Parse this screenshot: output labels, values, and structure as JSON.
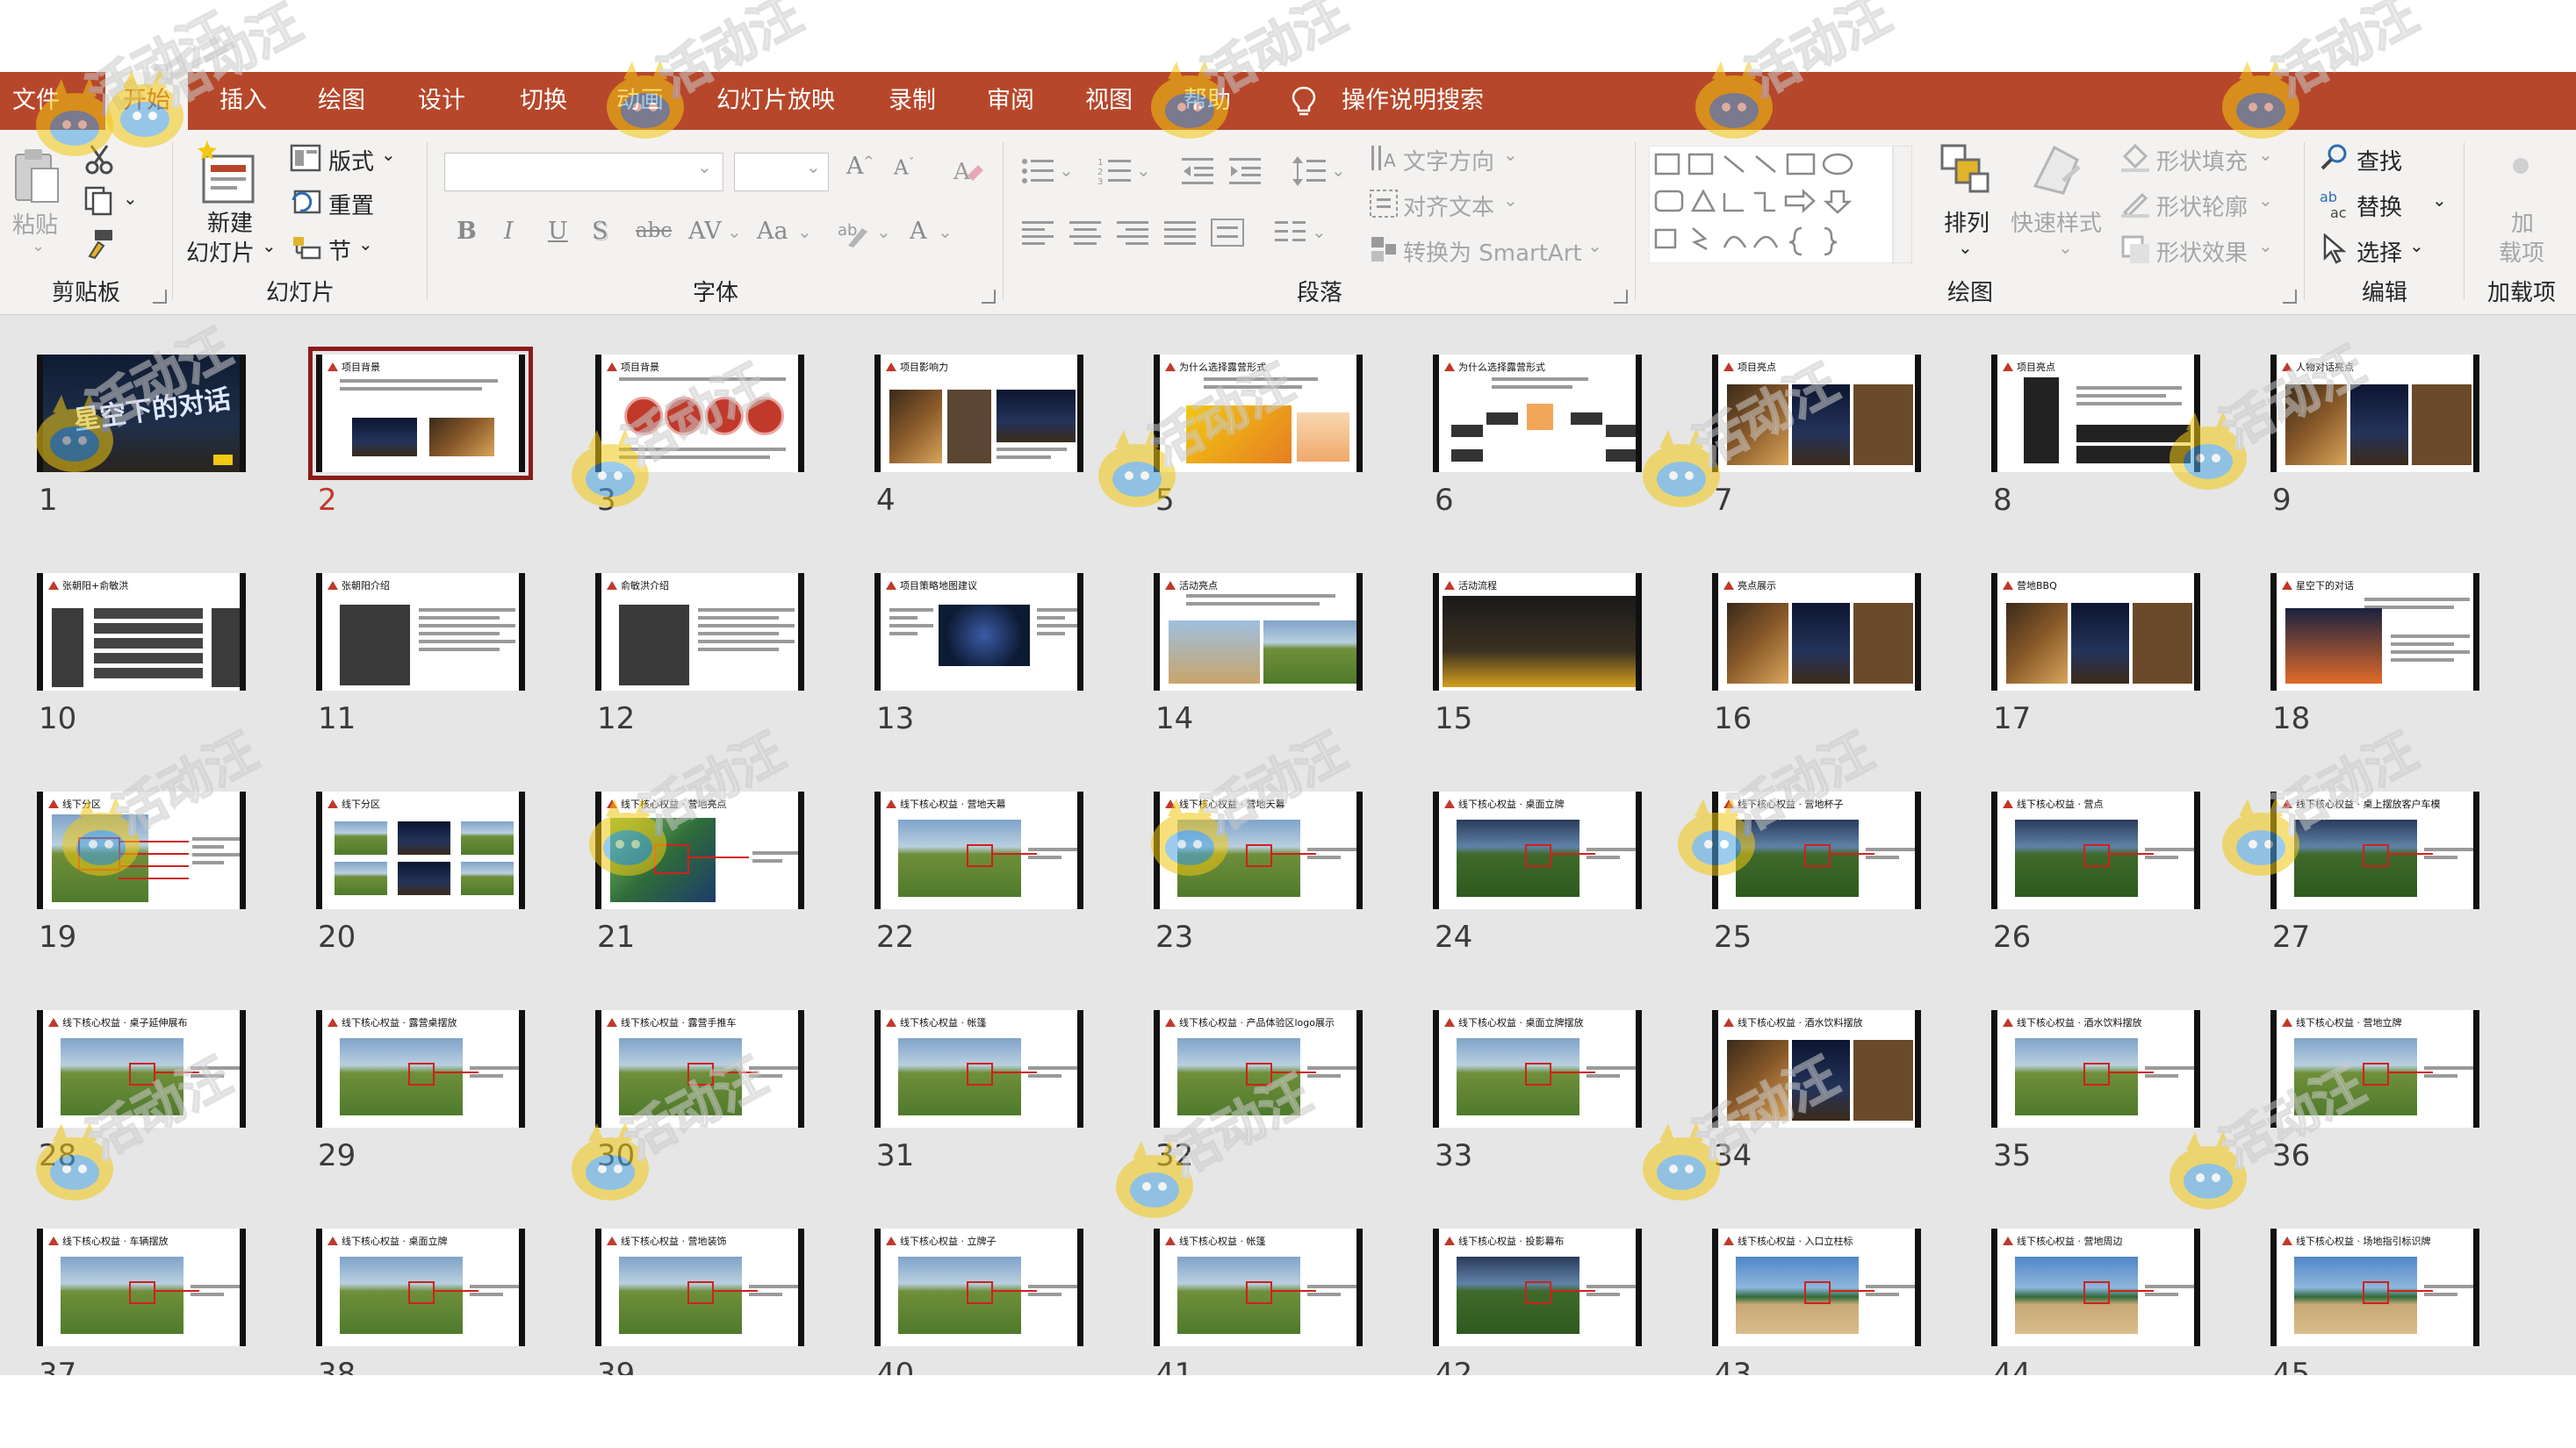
{
  "colors": {
    "accent": "#b7472a",
    "ribbon_bg": "#f3f2f1",
    "sorter_bg": "#e6e6e6",
    "selection": "#8b1b1b",
    "slide_red": "#c0392b"
  },
  "tabs": [
    {
      "label": "文件",
      "active": false
    },
    {
      "label": "开始",
      "active": true
    },
    {
      "label": "插入",
      "active": false
    },
    {
      "label": "绘图",
      "active": false
    },
    {
      "label": "设计",
      "active": false
    },
    {
      "label": "切换",
      "active": false
    },
    {
      "label": "动画",
      "active": false
    },
    {
      "label": "幻灯片放映",
      "active": false
    },
    {
      "label": "录制",
      "active": false
    },
    {
      "label": "审阅",
      "active": false
    },
    {
      "label": "视图",
      "active": false
    },
    {
      "label": "帮助",
      "active": false
    }
  ],
  "tell_me": {
    "label": "操作说明搜索",
    "icon": "lightbulb-icon"
  },
  "ribbon": {
    "clipboard": {
      "paste": "粘贴",
      "label": "剪贴板"
    },
    "slides": {
      "new_slide_line1": "新建",
      "new_slide_line2": "幻灯片",
      "layout": "版式",
      "reset": "重置",
      "section": "节",
      "label": "幻灯片"
    },
    "font": {
      "label": "字体",
      "bold": "B",
      "italic": "I",
      "underline": "U",
      "shadow": "S",
      "strike": "abc",
      "spacing": "AV",
      "case": "Aa",
      "color": "A"
    },
    "paragraph": {
      "text_direction": "文字方向",
      "align_text": "对齐文本",
      "smartart": "转换为 SmartArt",
      "label": "段落"
    },
    "drawing": {
      "arrange": "排列",
      "quick_styles": "快速样式",
      "shape_fill": "形状填充",
      "shape_outline": "形状轮廓",
      "shape_effects": "形状效果",
      "label": "绘图"
    },
    "editing": {
      "find": "查找",
      "replace": "替换",
      "select": "选择",
      "label": "编辑"
    },
    "addins": {
      "line1": "加",
      "line2": "载项",
      "label": "加载项"
    }
  },
  "slides": [
    {
      "n": "1",
      "title": "",
      "kind": "cover",
      "big": "星空下的对话"
    },
    {
      "n": "2",
      "title": "项目背景",
      "kind": "two-photo",
      "selected": true
    },
    {
      "n": "3",
      "title": "项目背景",
      "kind": "dots"
    },
    {
      "n": "4",
      "title": "项目影响力",
      "kind": "photo-dark"
    },
    {
      "n": "5",
      "title": "为什么选择露营形式",
      "kind": "chart"
    },
    {
      "n": "6",
      "title": "为什么选择露营形式",
      "kind": "flow"
    },
    {
      "n": "7",
      "title": "项目亮点",
      "kind": "photos3"
    },
    {
      "n": "8",
      "title": "项目亮点",
      "kind": "phone"
    },
    {
      "n": "9",
      "title": "人物对话亮点",
      "kind": "photos3"
    },
    {
      "n": "10",
      "title": "张朝阳+俞敏洪",
      "kind": "people"
    },
    {
      "n": "11",
      "title": "张朝阳介绍",
      "kind": "person"
    },
    {
      "n": "12",
      "title": "俞敏洪介绍",
      "kind": "person"
    },
    {
      "n": "13",
      "title": "项目策略地图建议",
      "kind": "map"
    },
    {
      "n": "14",
      "title": "活动亮点",
      "kind": "landscape"
    },
    {
      "n": "15",
      "title": "活动流程",
      "kind": "dark-wide"
    },
    {
      "n": "16",
      "title": "亮点展示",
      "kind": "photos3"
    },
    {
      "n": "17",
      "title": "营地BBQ",
      "kind": "photos3"
    },
    {
      "n": "18",
      "title": "星空下的对话",
      "kind": "cover-small"
    },
    {
      "n": "19",
      "title": "线下分区",
      "kind": "map-lines"
    },
    {
      "n": "20",
      "title": "线下分区",
      "kind": "grid6"
    },
    {
      "n": "21",
      "title": "线下核心权益 · 营地亮点",
      "kind": "diagram"
    },
    {
      "n": "22",
      "title": "线下核心权益 · 营地天幕",
      "kind": "field"
    },
    {
      "n": "23",
      "title": "线下核心权益 · 营地天幕",
      "kind": "field"
    },
    {
      "n": "24",
      "title": "线下核心权益 · 桌面立牌",
      "kind": "field-dark"
    },
    {
      "n": "25",
      "title": "线下核心权益 · 营地杯子",
      "kind": "field-dark"
    },
    {
      "n": "26",
      "title": "线下核心权益 · 营点",
      "kind": "field-dark"
    },
    {
      "n": "27",
      "title": "线下核心权益 · 桌上摆放客户车模",
      "kind": "field-dark"
    },
    {
      "n": "28",
      "title": "线下核心权益 · 桌子延伸展布",
      "kind": "field"
    },
    {
      "n": "29",
      "title": "线下核心权益 · 露营桌摆放",
      "kind": "field"
    },
    {
      "n": "30",
      "title": "线下核心权益 · 露营手推车",
      "kind": "field"
    },
    {
      "n": "31",
      "title": "线下核心权益 · 帐篷",
      "kind": "field"
    },
    {
      "n": "32",
      "title": "线下核心权益 · 产品体验区logo展示",
      "kind": "field"
    },
    {
      "n": "33",
      "title": "线下核心权益 · 桌面立牌摆放",
      "kind": "field"
    },
    {
      "n": "34",
      "title": "线下核心权益 · 酒水饮料摆放",
      "kind": "photos3"
    },
    {
      "n": "35",
      "title": "线下核心权益 · 酒水饮料摆放",
      "kind": "field"
    },
    {
      "n": "36",
      "title": "线下核心权益 · 营地立牌",
      "kind": "field"
    },
    {
      "n": "37",
      "title": "线下核心权益 · 车辆摆放",
      "kind": "field"
    },
    {
      "n": "38",
      "title": "线下核心权益 · 桌面立牌",
      "kind": "field"
    },
    {
      "n": "39",
      "title": "线下核心权益 · 营地装饰",
      "kind": "field"
    },
    {
      "n": "40",
      "title": "线下核心权益 · 立牌子",
      "kind": "field"
    },
    {
      "n": "41",
      "title": "线下核心权益 · 帐篷",
      "kind": "field"
    },
    {
      "n": "42",
      "title": "线下核心权益 · 投影幕布",
      "kind": "field-dark"
    },
    {
      "n": "43",
      "title": "线下核心权益 · 入口立柱标",
      "kind": "beach"
    },
    {
      "n": "44",
      "title": "线下核心权益 · 营地周边",
      "kind": "beach"
    },
    {
      "n": "45",
      "title": "线下核心权益 · 场地指引标识牌",
      "kind": "beach"
    }
  ],
  "watermark": {
    "text": "活动汪"
  }
}
